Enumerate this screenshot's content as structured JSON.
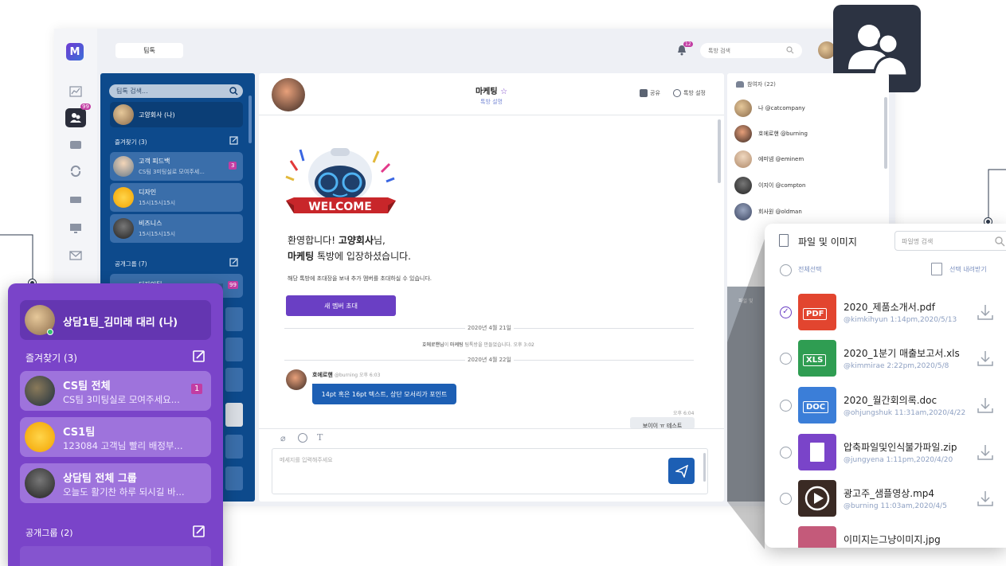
{
  "colors": {
    "brand": "#7a44c9",
    "sidebar": "#0d4a8c",
    "primary_button": "#6a3fc4",
    "message_bubble": "#1d5fb4",
    "badge": "#c23da3"
  },
  "topbar": {
    "tab_label": "팀톡",
    "search_placeholder": "톡방 검색",
    "notif_count": "12"
  },
  "rail": {
    "badge": "99"
  },
  "sidebar": {
    "search_placeholder": "팀톡 검색...",
    "me": "고양회사 (나)",
    "favorites_title": "즐겨찾기 (3)",
    "public_title": "공개그룹 (7)",
    "items": [
      {
        "name": "고객 피드백",
        "preview": "CS팀 3미팅실로 모여주세...",
        "badge": "3"
      },
      {
        "name": "디자인",
        "preview": "15시15시15시"
      },
      {
        "name": "비즈니스",
        "preview": "15시15시15시"
      }
    ],
    "public_first": "디자인팀",
    "public_badge": "99"
  },
  "chat": {
    "room_name": "마케팅",
    "room_sub": "톡방 설명",
    "share": "공유",
    "settings": "톡방 설정",
    "welcome_text": "WELCOME",
    "welcome_line1_a": "환영합니다! ",
    "welcome_line1_b": "고양회사",
    "welcome_line1_c": "님,",
    "welcome_line2_a": "마케팅",
    "welcome_line2_b": " 톡방에 입장하셨습니다.",
    "invite_desc": "해당 톡방에 초대장을 보내 추가 멤버를 초대하실 수 있습니다.",
    "invite_button": "새 멤버 초대",
    "date1": "2020년 4월 21일",
    "system_a": "호에로핸님",
    "system_b": "이 ",
    "system_c": "마케팅",
    "system_d": " 팀톡방을 만들었습니다. 오후 3:02",
    "date2": "2020년 4월 22일",
    "sender": "호에로핸",
    "sender_meta": "@burning 오후 6:03",
    "message": "14pt 혹은 16pt 텍스트, 상단 모서리가 포인트",
    "my_time": "오후 6:04",
    "my_message": "보이이 ㅠ 테스트",
    "input_placeholder": "메세지를 입력해주세요"
  },
  "participants": {
    "title": "참여자 (22)",
    "list": [
      {
        "name": "나 @catcompany"
      },
      {
        "name": "호에로핸 @burning"
      },
      {
        "name": "에미넴 @eminem"
      },
      {
        "name": "이지이 @compton"
      },
      {
        "name": "회사원 @oldman"
      }
    ],
    "files_label": "파일 및"
  },
  "popup_left": {
    "me": "상담1팀_김미래 대리 (나)",
    "favorites_title": "즐겨찾기 (3)",
    "items": [
      {
        "name": "CS팀 전체",
        "preview": "CS팀 3미팅실로 모여주세요...",
        "badge": "1"
      },
      {
        "name": "CS1팀",
        "preview": "123084 고객님 빨리 배정부..."
      },
      {
        "name": "상담팀 전체 그룹",
        "preview": "오늘도 활기찬 하루 되시길 바..."
      }
    ],
    "public_title": "공개그룹 (2)"
  },
  "popup_right": {
    "title": "파일 및 이미지",
    "search_placeholder": "파일명 검색",
    "select_all": "전체선택",
    "download_selected": "선택 내려받기",
    "files": [
      {
        "tag": "PDF",
        "name": "2020_제품소개서.pdf",
        "meta": "@kimkihyun 1:14pm,2020/5/13",
        "color": "#e2452f",
        "checked": true
      },
      {
        "tag": "XLS",
        "name": "2020_1분기 매출보고서.xls",
        "meta": "@kimmirae 2:22pm,2020/5/8",
        "color": "#2f9d52",
        "checked": false
      },
      {
        "tag": "DOC",
        "name": "2020_월간회의록.doc",
        "meta": "@ohjungshuk 11:31am,2020/4/22",
        "color": "#3b7ed8",
        "checked": false
      },
      {
        "tag": "",
        "name": "압축파일및인식불가파일.zip",
        "meta": "@jungyena 1:11pm,2020/4/20",
        "color": "#7a44c9",
        "checked": false
      },
      {
        "tag": "",
        "name": "광고주_샘플영상.mp4",
        "meta": "@burning 11:03am,2020/4/5",
        "color": "#3a2a24",
        "checked": false
      },
      {
        "tag": "",
        "name": "이미지는그냥이미지.jpg",
        "meta": "",
        "color": "#c45a7a",
        "checked": false
      }
    ]
  }
}
